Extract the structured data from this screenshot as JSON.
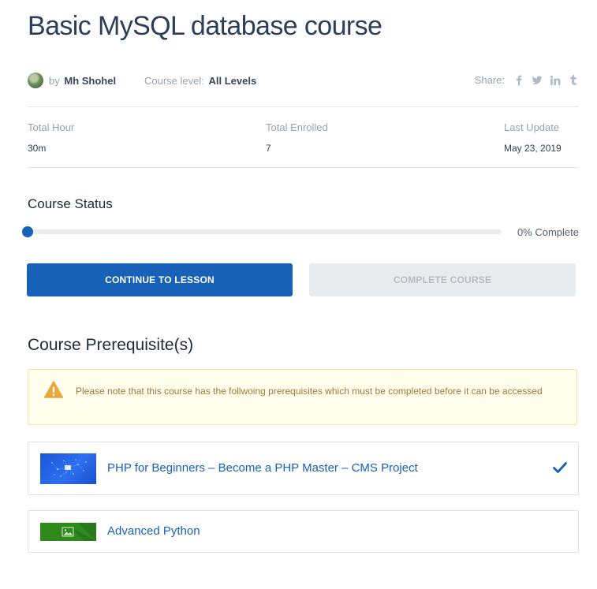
{
  "course": {
    "title": "Basic MySQL database course",
    "by_prefix": "by",
    "author": "Mh Shohel",
    "level_label": "Course level:",
    "level_value": "All Levels",
    "share_label": "Share:",
    "share_icons": [
      "facebook-icon",
      "twitter-icon",
      "linkedin-icon",
      "tumblr-icon"
    ]
  },
  "stats": [
    {
      "label": "Total Hour",
      "value": "30m"
    },
    {
      "label": "Total Enrolled",
      "value": "7"
    },
    {
      "label": "Last Update",
      "value": "May 23, 2019"
    }
  ],
  "status": {
    "heading": "Course Status",
    "progress_percent": 0,
    "progress_text": "0% Complete",
    "continue_label": "CONTINUE TO LESSON",
    "complete_label": "COMPLETE COURSE"
  },
  "prerequisites": {
    "heading": "Course Prerequisite(s)",
    "notice": "Please note that this course has the follwoing prerequisites which must be completed before it can be accessed",
    "items": [
      {
        "title": "PHP for Beginners – Become a PHP Master – CMS Project",
        "completed": true
      },
      {
        "title": "Advanced Python",
        "completed": false
      }
    ]
  },
  "colors": {
    "primary": "#1761b8",
    "title": "#2c3e5a",
    "notice_bg": "#fffdeb",
    "notice_text": "#a3793a",
    "warning_icon": "#e9a93a",
    "disabled_bg": "#e9ecef"
  }
}
